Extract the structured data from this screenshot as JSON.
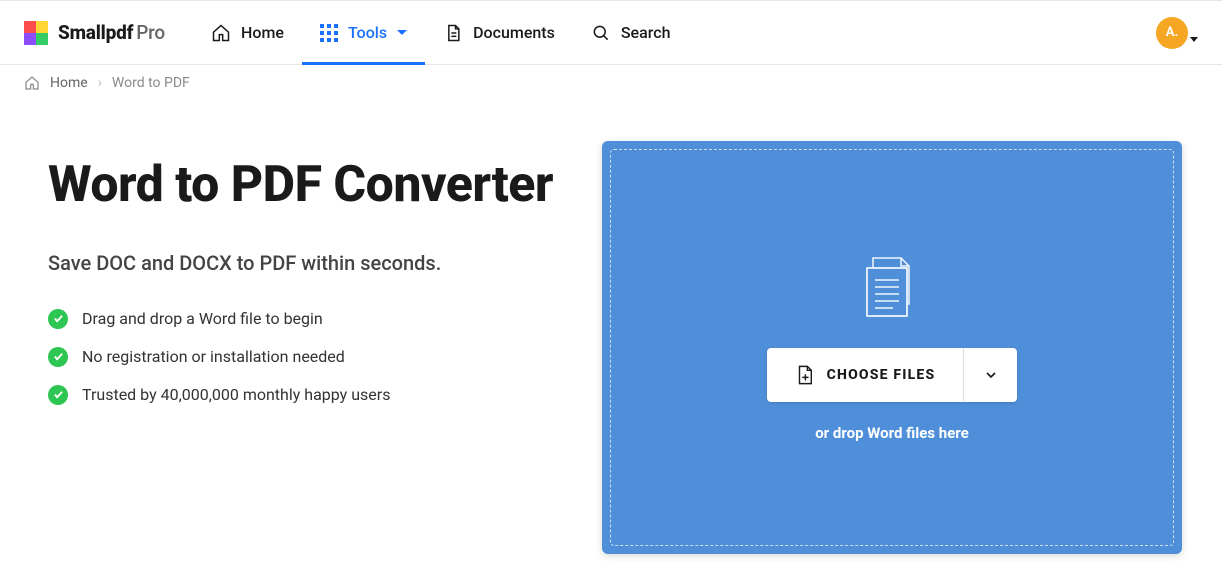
{
  "brand": {
    "name": "Smallpdf",
    "suffix": "Pro"
  },
  "nav": {
    "home": "Home",
    "tools": "Tools",
    "documents": "Documents",
    "search": "Search"
  },
  "avatar": {
    "initial": "A."
  },
  "breadcrumb": {
    "home": "Home",
    "current": "Word to PDF"
  },
  "page": {
    "title": "Word to PDF Converter",
    "subtitle": "Save DOC and DOCX to PDF within seconds."
  },
  "features": [
    "Drag and drop a Word file to begin",
    "No registration or installation needed",
    "Trusted by 40,000,000 monthly happy users"
  ],
  "dropzone": {
    "choose_label": "CHOOSE FILES",
    "drop_text": "or drop Word files here"
  }
}
